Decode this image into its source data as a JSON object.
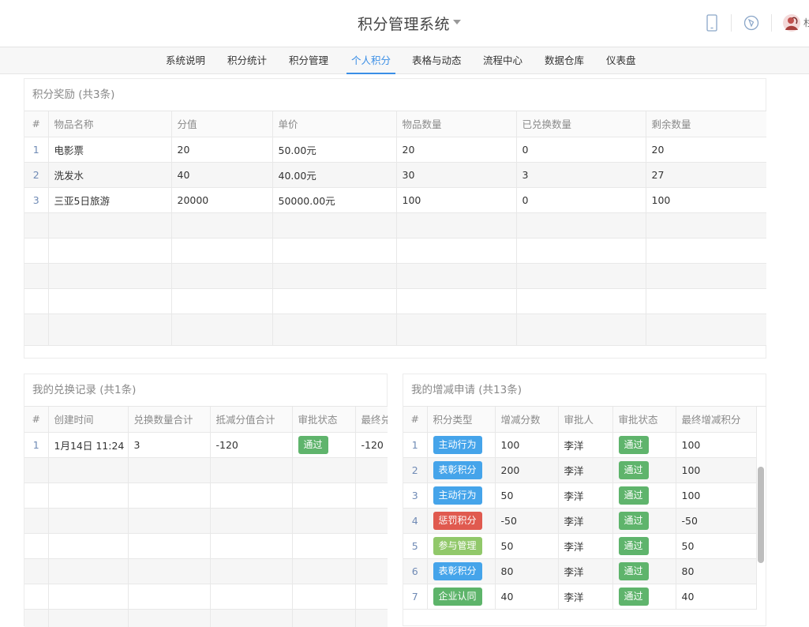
{
  "app": {
    "title": "积分管理系统",
    "user_name": "杉"
  },
  "colors": {
    "accent": "#3a8ee6",
    "tag_blue": "#45a4ea",
    "tag_red": "#e05a4f",
    "tag_light_green": "#91c86a",
    "tag_green": "#5db46a"
  },
  "header_icons": [
    "mobile-icon",
    "compass-icon",
    "avatar"
  ],
  "nav": {
    "items": [
      {
        "label": "系统说明"
      },
      {
        "label": "积分统计"
      },
      {
        "label": "积分管理"
      },
      {
        "label": "个人积分",
        "active": true
      },
      {
        "label": "表格与动态"
      },
      {
        "label": "流程中心"
      },
      {
        "label": "数据仓库"
      },
      {
        "label": "仪表盘"
      }
    ]
  },
  "rewards": {
    "title": "积分奖励 (共3条)",
    "columns": [
      "#",
      "物品名称",
      "分值",
      "单价",
      "物品数量",
      "已兑换数量",
      "剩余数量"
    ],
    "rows": [
      [
        "1",
        "电影票",
        "20",
        "50.00元",
        "20",
        "0",
        "20"
      ],
      [
        "2",
        "洗发水",
        "40",
        "40.00元",
        "30",
        "3",
        "27"
      ],
      [
        "3",
        "三亚5日旅游",
        "20000",
        "50000.00元",
        "100",
        "0",
        "100"
      ]
    ]
  },
  "exchanges": {
    "title": "我的兑换记录 (共1条)",
    "columns": [
      "#",
      "创建时间",
      "兑换数量合计",
      "抵减分值合计",
      "审批状态",
      "最终兑"
    ],
    "rows": [
      {
        "idx": "1",
        "time": "1月14日 11:24",
        "qty": "3",
        "points": "-120",
        "status": "通过",
        "final": "-120"
      }
    ]
  },
  "applications": {
    "title": "我的增减申请 (共13条)",
    "columns": [
      "#",
      "积分类型",
      "增减分数",
      "审批人",
      "审批状态",
      "最终增减积分"
    ],
    "rows": [
      {
        "idx": "1",
        "type": "主动行为",
        "type_color": "blue",
        "delta": "100",
        "approver": "李洋",
        "status": "通过",
        "final": "100"
      },
      {
        "idx": "2",
        "type": "表彰积分",
        "type_color": "blue",
        "delta": "200",
        "approver": "李洋",
        "status": "通过",
        "final": "100"
      },
      {
        "idx": "3",
        "type": "主动行为",
        "type_color": "blue",
        "delta": "50",
        "approver": "李洋",
        "status": "通过",
        "final": "100"
      },
      {
        "idx": "4",
        "type": "惩罚积分",
        "type_color": "red",
        "delta": "-50",
        "approver": "李洋",
        "status": "通过",
        "final": "-50"
      },
      {
        "idx": "5",
        "type": "参与管理",
        "type_color": "lgreen",
        "delta": "50",
        "approver": "李洋",
        "status": "通过",
        "final": "50"
      },
      {
        "idx": "6",
        "type": "表彰积分",
        "type_color": "blue",
        "delta": "80",
        "approver": "李洋",
        "status": "通过",
        "final": "80"
      },
      {
        "idx": "7",
        "type": "企业认同",
        "type_color": "green",
        "delta": "40",
        "approver": "李洋",
        "status": "通过",
        "final": "40"
      }
    ]
  }
}
